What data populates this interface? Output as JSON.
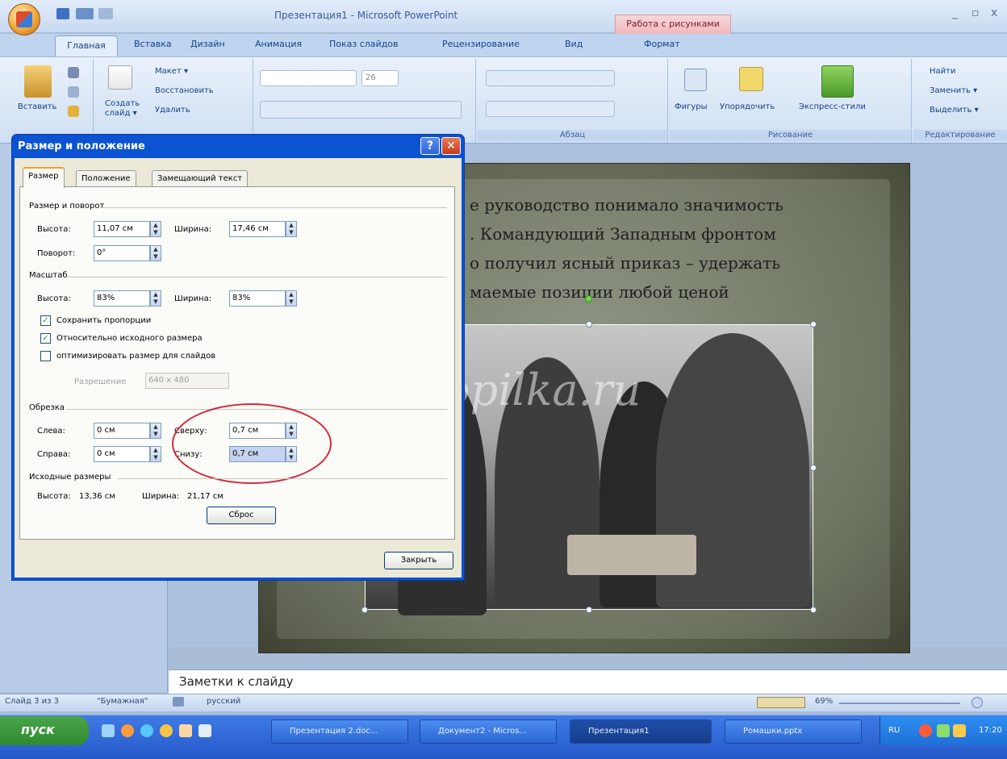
{
  "app": {
    "title": "Презентация1 - Microsoft PowerPoint",
    "context_group": "Работа с рисунками",
    "window_controls": [
      "_",
      "▫",
      "x"
    ]
  },
  "ribbon_tabs": [
    "Главная",
    "Вставка",
    "Дизайн",
    "Анимация",
    "Показ слайдов",
    "Рецензирование",
    "Вид",
    "Формат"
  ],
  "ribbon": {
    "paste": "Вставить",
    "new_slide_l1": "Создать",
    "new_slide_l2": "слайд ▾",
    "layout": "Макет ▾",
    "reset": "Восстановить",
    "delete": "Удалить",
    "font_size": "26",
    "paragraph_group": "Абзац",
    "shapes": "Фигуры",
    "arrange": "Упорядочить",
    "quick_styles": "Экспресс-стили",
    "drawing_group": "Рисование",
    "find": "Найти",
    "replace": "Заменить ▾",
    "select": "Выделить ▾",
    "editing_group": "Редактирование"
  },
  "dialog": {
    "title": "Размер и положение",
    "help": "?",
    "close": "✕",
    "tabs": [
      "Размер",
      "Положение",
      "Замещающий текст"
    ],
    "size_rotate": "Размер и поворот",
    "height_label": "Высота:",
    "height_value": "11,07 см",
    "width_label": "Ширина:",
    "width_value": "17,46 см",
    "rotation_label": "Поворот:",
    "rotation_value": "0°",
    "scale": "Масштаб",
    "scale_height_label": "Высота:",
    "scale_height_value": "83%",
    "scale_width_label": "Ширина:",
    "scale_width_value": "83%",
    "lock_aspect": "Сохранить пропорции",
    "relative_original": "Относительно исходного размера",
    "best_scale": "оптимизировать размер для слайдов",
    "resolution_label": "Разрешение",
    "resolution_value": "640 x 480",
    "crop": "Обрезка",
    "left_label": "Слева:",
    "left_value": "0 см",
    "top_label": "Сверху:",
    "top_value": "0,7 см",
    "right_label": "Справа:",
    "right_value": "0 см",
    "bottom_label": "Снизу:",
    "bottom_value": "0,7 см",
    "original": "Исходные размеры",
    "original_height_label": "Высота:",
    "original_height_value": "13,36 см",
    "original_width_label": "Ширина:",
    "original_width_value": "21,17 см",
    "reset_button": "Сброс",
    "close_button": "Закрыть"
  },
  "slide": {
    "text_lines": [
      "е руководство понимало значимость",
      ". Командующий Западным фронтом",
      "о получил ясный приказ – удержать",
      "маемые позиции любой ценой"
    ],
    "watermark": "ped-kopilka.ru"
  },
  "notes": {
    "placeholder": "Заметки к слайду"
  },
  "status": {
    "slide": "Слайд 3 из 3",
    "theme": "\"Бумажная\"",
    "language": "русский",
    "zoom": "69%"
  },
  "taskbar": {
    "start": "пуск",
    "buttons": [
      "Презентация 2.doc...",
      "Документ2 - Micros...",
      "Презентация1",
      "Ромашки.pptx"
    ],
    "lang": "RU",
    "time": "17:20"
  },
  "colors": {
    "dialog_title": "#0b53d3",
    "ribbon_bg": "#dbe6f5",
    "context_tab": "#f0b8bd"
  }
}
